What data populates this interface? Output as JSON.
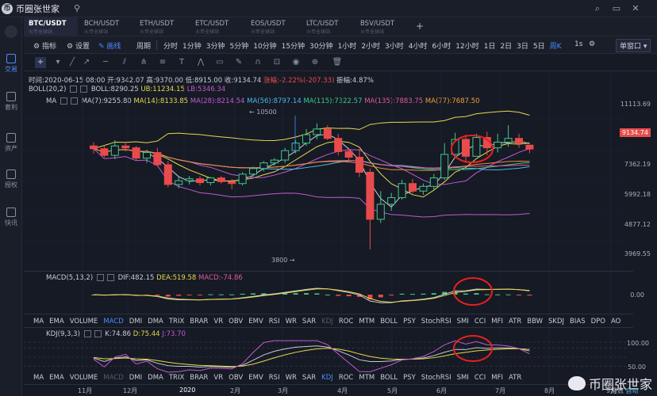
{
  "app": {
    "name": "币圈张世家",
    "logo_glyph": "币"
  },
  "topbar": {
    "icons": [
      "lock-icon",
      "search-icon",
      "window-icon",
      "close-icon"
    ]
  },
  "sidebar": {
    "items": [
      {
        "label": "交易",
        "icon": "chart-icon",
        "active": true
      },
      {
        "label": "套利",
        "icon": "arbitrage-icon",
        "active": false
      },
      {
        "label": "资产",
        "icon": "wallet-icon",
        "active": false
      },
      {
        "label": "授权",
        "icon": "key-icon",
        "active": false
      },
      {
        "label": "快讯",
        "icon": "news-icon",
        "active": false
      }
    ]
  },
  "pairs": [
    {
      "name": "BTC/USDT",
      "sub": "火币全球站",
      "active": true
    },
    {
      "name": "BCH/USDT",
      "sub": "火币全球站",
      "active": false
    },
    {
      "name": "ETH/USDT",
      "sub": "火币全球站",
      "active": false
    },
    {
      "name": "ETC/USDT",
      "sub": "火币全球站",
      "active": false
    },
    {
      "name": "EOS/USDT",
      "sub": "火币全球站",
      "active": false
    },
    {
      "name": "LTC/USDT",
      "sub": "火币全球站",
      "active": false
    },
    {
      "name": "BSV/USDT",
      "sub": "火币全球站",
      "active": false
    }
  ],
  "add_pair": "+",
  "toolbar": {
    "indicators": "指标",
    "settings": "设置",
    "draw": "画线",
    "period_label": "周期",
    "periods": [
      "分时",
      "1分钟",
      "3分钟",
      "5分钟",
      "10分钟",
      "15分钟",
      "30分钟",
      "1小时",
      "2小时",
      "3小时",
      "4小时",
      "6小时",
      "12小时",
      "1日",
      "2日",
      "3日",
      "5日",
      "周K"
    ],
    "active_period": "周K",
    "refresh": "1s",
    "window_mode": "单窗口"
  },
  "ohlc": {
    "time": "时间:2020-06-15 08:00",
    "open": "开:9342.07",
    "high": "高:9370.00",
    "low": "低:8915.00",
    "close": "收:9134.74",
    "change": "涨幅:-2.22%(-207.33)",
    "amplitude": "振幅:4.87%"
  },
  "boll": {
    "label": "BOLL(20,2)",
    "mid": "BOLL:8290.25",
    "ub": "UB:11234.15",
    "lb": "LB:5346.34"
  },
  "ma": {
    "label": "MA",
    "values": [
      {
        "text": "MA(7):9255.80",
        "color": "#c8ccd6"
      },
      {
        "text": "MA(14):8133.85",
        "color": "#e8d84a"
      },
      {
        "text": "MA(28):8214.54",
        "color": "#c05ad0"
      },
      {
        "text": "MA(56):8797.14",
        "color": "#4ab8e8"
      },
      {
        "text": "MA(115):7322.57",
        "color": "#3ec88a"
      },
      {
        "text": "MA(135):7883.75",
        "color": "#e05a9a"
      },
      {
        "text": "MA(77):7687.50",
        "color": "#f08a3a"
      }
    ]
  },
  "price_axis": [
    "11113.69",
    "9134.74",
    "7362.19",
    "5992.18",
    "4877.12",
    "3969.55"
  ],
  "current_price": "9134.74",
  "annotations": {
    "high": "10500",
    "low": "3800"
  },
  "macd": {
    "label": "MACD(5,13,2)",
    "dif": "DIF:482.15",
    "dea": "DEA:519.58",
    "macd": "MACD:-74.86",
    "axis": "0.00"
  },
  "indicator_tabs_1": [
    "MA",
    "EMA",
    "VOLUME",
    "MACD",
    "DMI",
    "DMA",
    "TRIX",
    "BRAR",
    "VR",
    "OBV",
    "EMV",
    "RSI",
    "WR",
    "SAR",
    "KDJ",
    "ROC",
    "MTM",
    "BOLL",
    "PSY",
    "StochRSI",
    "SMI",
    "CCI",
    "MFI",
    "ATR",
    "BBW",
    "SKDJ",
    "BIAS",
    "DPO",
    "AO"
  ],
  "indicator_tabs_1_active": "MACD",
  "indicator_tabs_1_dim": [
    "KDJ"
  ],
  "kdj": {
    "label": "KDJ(9,3,3)",
    "k": "K:74.86",
    "d": "D:75.44",
    "j": "J:73.70",
    "axis_top": "100.00",
    "axis_mid": "50.00"
  },
  "indicator_tabs_2": [
    "MA",
    "EMA",
    "VOLUME",
    "MACD",
    "DMI",
    "DMA",
    "TRIX",
    "BRAR",
    "VR",
    "OBV",
    "EMV",
    "RSI",
    "WR",
    "SAR",
    "KDJ",
    "ROC",
    "MTM",
    "BOLL",
    "PSY",
    "StochRSI",
    "SMI",
    "CCI",
    "MFI",
    "ATR"
  ],
  "indicator_tabs_2_active": "KDJ",
  "indicator_tabs_2_dim": [
    "MACD"
  ],
  "time_axis": [
    "11月",
    "12月",
    "2020",
    "2月",
    "3月",
    "4月",
    "5月",
    "6月",
    "7月",
    "8月",
    "9月"
  ],
  "footer_right": {
    "prefix": "对数",
    "value": "自动"
  },
  "watermark": "币圈张世家",
  "colors": {
    "up": "#3ec88a",
    "down": "#e84b4b",
    "accent": "#4a8cff",
    "bg": "#161a25",
    "highlight_circle": "#e82020"
  },
  "chart_data": {
    "type": "candlestick",
    "interval": "weekly",
    "pair": "BTC/USDT",
    "candles": [
      {
        "o": 9300,
        "h": 9500,
        "l": 8900,
        "c": 9150
      },
      {
        "o": 9150,
        "h": 9350,
        "l": 8700,
        "c": 8800
      },
      {
        "o": 8800,
        "h": 9600,
        "l": 8600,
        "c": 9300
      },
      {
        "o": 9300,
        "h": 9450,
        "l": 9000,
        "c": 9200
      },
      {
        "o": 9200,
        "h": 9300,
        "l": 8500,
        "c": 8650
      },
      {
        "o": 8650,
        "h": 9100,
        "l": 8400,
        "c": 8950
      },
      {
        "o": 8950,
        "h": 9200,
        "l": 8200,
        "c": 8300
      },
      {
        "o": 8300,
        "h": 8500,
        "l": 7100,
        "c": 7250
      },
      {
        "o": 7250,
        "h": 7650,
        "l": 7050,
        "c": 7450
      },
      {
        "o": 7450,
        "h": 7700,
        "l": 7250,
        "c": 7550
      },
      {
        "o": 7550,
        "h": 7700,
        "l": 7200,
        "c": 7350
      },
      {
        "o": 7350,
        "h": 7650,
        "l": 7200,
        "c": 7600
      },
      {
        "o": 7600,
        "h": 7700,
        "l": 7300,
        "c": 7400
      },
      {
        "o": 7400,
        "h": 7550,
        "l": 7000,
        "c": 7300
      },
      {
        "o": 7300,
        "h": 7900,
        "l": 7200,
        "c": 7800
      },
      {
        "o": 7800,
        "h": 8200,
        "l": 7650,
        "c": 8100
      },
      {
        "o": 8100,
        "h": 8500,
        "l": 7950,
        "c": 8400
      },
      {
        "o": 8400,
        "h": 8650,
        "l": 8250,
        "c": 8550
      },
      {
        "o": 8550,
        "h": 9200,
        "l": 8400,
        "c": 9050
      },
      {
        "o": 9050,
        "h": 9600,
        "l": 8900,
        "c": 9450
      },
      {
        "o": 9450,
        "h": 10200,
        "l": 9300,
        "c": 9900
      },
      {
        "o": 9900,
        "h": 10500,
        "l": 9650,
        "c": 10200
      },
      {
        "o": 10200,
        "h": 10400,
        "l": 9600,
        "c": 9700
      },
      {
        "o": 9700,
        "h": 9950,
        "l": 8800,
        "c": 9000
      },
      {
        "o": 9000,
        "h": 9200,
        "l": 8500,
        "c": 8700
      },
      {
        "o": 8700,
        "h": 9150,
        "l": 7650,
        "c": 7900
      },
      {
        "o": 7900,
        "h": 8100,
        "l": 3800,
        "c": 5400
      },
      {
        "o": 5400,
        "h": 6900,
        "l": 5200,
        "c": 6200
      },
      {
        "o": 6200,
        "h": 6800,
        "l": 5850,
        "c": 6550
      },
      {
        "o": 6550,
        "h": 7500,
        "l": 6450,
        "c": 7300
      },
      {
        "o": 7300,
        "h": 7550,
        "l": 6800,
        "c": 6900
      },
      {
        "o": 6900,
        "h": 7300,
        "l": 6700,
        "c": 7150
      },
      {
        "o": 7150,
        "h": 7800,
        "l": 6950,
        "c": 7600
      },
      {
        "o": 7600,
        "h": 9450,
        "l": 7500,
        "c": 8850
      },
      {
        "o": 8850,
        "h": 10000,
        "l": 8700,
        "c": 9650
      },
      {
        "o": 9650,
        "h": 9900,
        "l": 8400,
        "c": 8750
      },
      {
        "o": 8750,
        "h": 9950,
        "l": 8800,
        "c": 9750
      },
      {
        "o": 9750,
        "h": 10050,
        "l": 8800,
        "c": 9200
      },
      {
        "o": 9200,
        "h": 9950,
        "l": 8950,
        "c": 9500
      },
      {
        "o": 9500,
        "h": 10400,
        "l": 9250,
        "c": 9700
      },
      {
        "o": 9700,
        "h": 9950,
        "l": 9200,
        "c": 9450
      },
      {
        "o": 9342.07,
        "h": 9370,
        "l": 8915,
        "c": 9134.74
      }
    ],
    "ylim": [
      3500,
      11500
    ]
  }
}
